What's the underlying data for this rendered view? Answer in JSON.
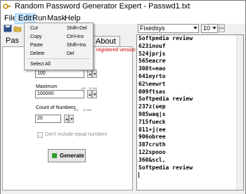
{
  "window": {
    "title": "Random Password Generator Expert - Passwd1.txt"
  },
  "menubar": {
    "items": [
      {
        "label": "File"
      },
      {
        "label": "Edit"
      },
      {
        "label": "Run"
      },
      {
        "label": "Mask"
      },
      {
        "label": "Help"
      }
    ]
  },
  "edit_menu": {
    "items": [
      {
        "label": "Cut",
        "shortcut": "Shift+Del"
      },
      {
        "label": "Copy",
        "shortcut": "Ctrl+Ins"
      },
      {
        "label": "Paste",
        "shortcut": "Shift+Ins"
      },
      {
        "label": "Delete",
        "shortcut": "Del"
      },
      {
        "label": "Select All",
        "shortcut": ""
      }
    ]
  },
  "toolbar": {
    "font": "Fixedsys",
    "font_size": "10"
  },
  "tabs": {
    "left_partial": "Pas",
    "about": "About"
  },
  "settings": {
    "registered_text": "registered version",
    "minimum": {
      "value": "100"
    },
    "maximum": {
      "label": "Maximum",
      "value": "100000",
      "scale": [
        "100",
        "10 000"
      ]
    },
    "count": {
      "label": "Count of Numbers",
      "value": "20",
      "scale": [
        "100",
        "10 000"
      ]
    },
    "no_equal_label": "Don't include equal numbers",
    "generate_label": "Generate"
  },
  "output": {
    "lines": [
      "Softpedia review",
      "623inouf",
      "524jprjs",
      "565eacre",
      "308t=eao",
      "641eyrto",
      "62%eewrt",
      "009ftsas",
      "Softpedia review",
      "237z(uep",
      "985waq|s",
      "715fueck",
      "811+j(ee",
      "906obree",
      "387cruth",
      "122spooo",
      "360&scl,",
      "Softpedia review"
    ]
  },
  "colors": {
    "registered": "#cc0000",
    "menu_highlight": "#cce8ff",
    "generate_icon": "#2e9e2e"
  }
}
